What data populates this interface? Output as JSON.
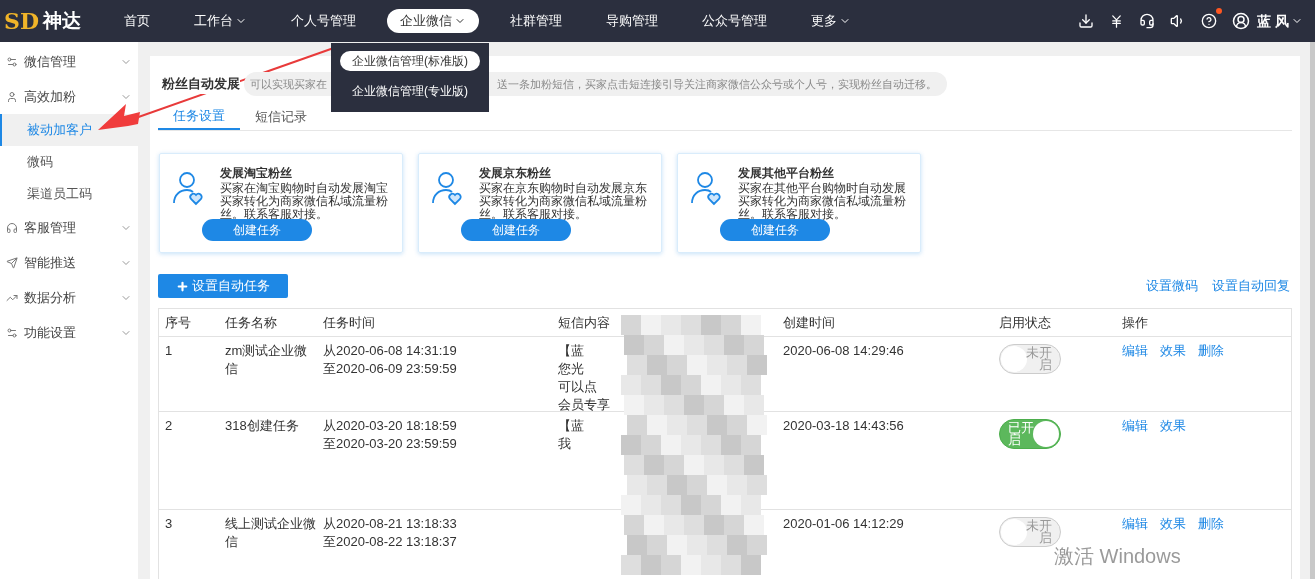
{
  "nav": {
    "logo_mark": "SD",
    "logo_text": "神达",
    "items": [
      {
        "label": "首页",
        "selected": false,
        "has_caret": false
      },
      {
        "label": "工作台",
        "selected": false,
        "has_caret": true
      },
      {
        "label": "个人号管理",
        "selected": false,
        "has_caret": false
      },
      {
        "label": "企业微信",
        "selected": true,
        "has_caret": true
      },
      {
        "label": "社群管理",
        "selected": false,
        "has_caret": false
      },
      {
        "label": "导购管理",
        "selected": false,
        "has_caret": false
      },
      {
        "label": "公众号管理",
        "selected": false,
        "has_caret": false
      },
      {
        "label": "更多",
        "selected": false,
        "has_caret": true
      }
    ],
    "has_notification": true,
    "user": "蓝 风"
  },
  "dropdown": {
    "items": [
      {
        "label": "企业微信管理(标准版)",
        "selected": true
      },
      {
        "label": "企业微信管理(专业版)",
        "selected": false
      }
    ]
  },
  "sidebar": {
    "items": [
      {
        "label": "微信管理"
      },
      {
        "label": "高效加粉",
        "children": [
          {
            "label": "被动加客户",
            "selected": true
          },
          {
            "label": "微码",
            "selected": false
          },
          {
            "label": "渠道员工码",
            "selected": false
          }
        ]
      },
      {
        "label": "客服管理"
      },
      {
        "label": "智能推送"
      },
      {
        "label": "数据分析"
      },
      {
        "label": "功能设置"
      }
    ]
  },
  "page": {
    "title": "粉丝自动发展",
    "description_parts": [
      "可以实现买家在",
      "送一条加粉短信，买家点击短连接引导关注商家微信公众号或个人号，实现粉丝自动迁移。"
    ],
    "tabs": [
      {
        "label": "任务设置",
        "selected": true
      },
      {
        "label": "短信记录",
        "selected": false
      }
    ],
    "cards": [
      {
        "title": "发展淘宝粉丝",
        "description": "买家在淘宝购物时自动发展淘宝买家转化为商家微信私域流量粉丝。联系客服对接。",
        "button": "创建任务"
      },
      {
        "title": "发展京东粉丝",
        "description": "买家在京东购物时自动发展京东买家转化为商家微信私域流量粉丝。联系客服对接。",
        "button": "创建任务"
      },
      {
        "title": "发展其他平台粉丝",
        "description": "买家在其他平台购物时自动发展买家转化为商家微信私域流量粉丝。联系客服对接。",
        "button": "创建任务"
      }
    ],
    "add_button": "设置自动任务",
    "links": [
      "设置微码",
      "设置自动回复"
    ],
    "table": {
      "columns": [
        "序号",
        "任务名称",
        "任务时间",
        "短信内容",
        "创建时间",
        "启用状态",
        "操作"
      ],
      "rows": [
        {
          "index": "1",
          "name": "zm测试企业微信",
          "time_from": "从2020-06-08 14:31:19",
          "time_to": "至2020-06-09 23:59:59",
          "sms_lines": [
            "【蓝",
            "您光",
            "可以点",
            "会员专享"
          ],
          "created": "2020-06-08 14:29:46",
          "status": "未开启",
          "on": false,
          "actions": [
            "编辑",
            "效果",
            "删除"
          ]
        },
        {
          "index": "2",
          "name": "318创建任务",
          "time_from": "从2020-03-20 18:18:59",
          "time_to": "至2020-03-20 23:59:59",
          "sms_lines": [
            "【蓝",
            "我"
          ],
          "created": "2020-03-18 14:43:56",
          "status": "已开启",
          "on": true,
          "actions": [
            "编辑",
            "效果"
          ]
        },
        {
          "index": "3",
          "name": "线上测试企业微信",
          "time_from": "从2020-08-21 13:18:33",
          "time_to": "至2020-08-22 13:18:37",
          "sms_lines": [],
          "created": "2020-01-06 14:12:29",
          "status": "未开启",
          "on": false,
          "actions": [
            "编辑",
            "效果",
            "删除"
          ]
        }
      ]
    }
  },
  "os_watermark": "激活 Windows"
}
